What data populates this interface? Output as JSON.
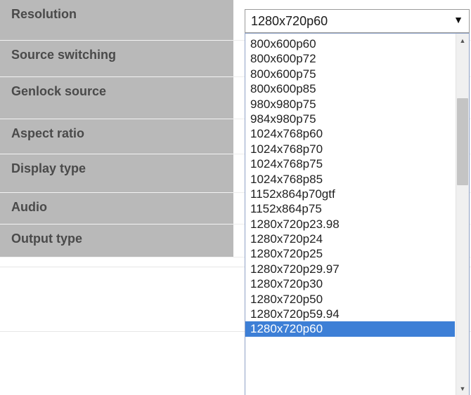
{
  "settings": {
    "labels": [
      "Resolution",
      "Source switching",
      "Genlock source",
      "Aspect ratio",
      "Display type",
      "Audio",
      "Output type"
    ]
  },
  "resolution_select": {
    "selected_value": "1280x720p60",
    "arrow_glyph": "▼",
    "options": [
      "800x600p60",
      "800x600p72",
      "800x600p75",
      "800x600p85",
      "980x980p75",
      "984x980p75",
      "1024x768p60",
      "1024x768p70",
      "1024x768p75",
      "1024x768p85",
      "1152x864p70gtf",
      "1152x864p75",
      "1280x720p23.98",
      "1280x720p24",
      "1280x720p25",
      "1280x720p29.97",
      "1280x720p30",
      "1280x720p50",
      "1280x720p59.94",
      "1280x720p60"
    ],
    "highlighted_option": "1280x720p60"
  },
  "scrollbar": {
    "up_glyph": "▲",
    "down_glyph": "▼"
  },
  "colors": {
    "label_background": "#b9b9b9",
    "label_text": "#4a4a4a",
    "selection_highlight": "#3d7fd6"
  }
}
